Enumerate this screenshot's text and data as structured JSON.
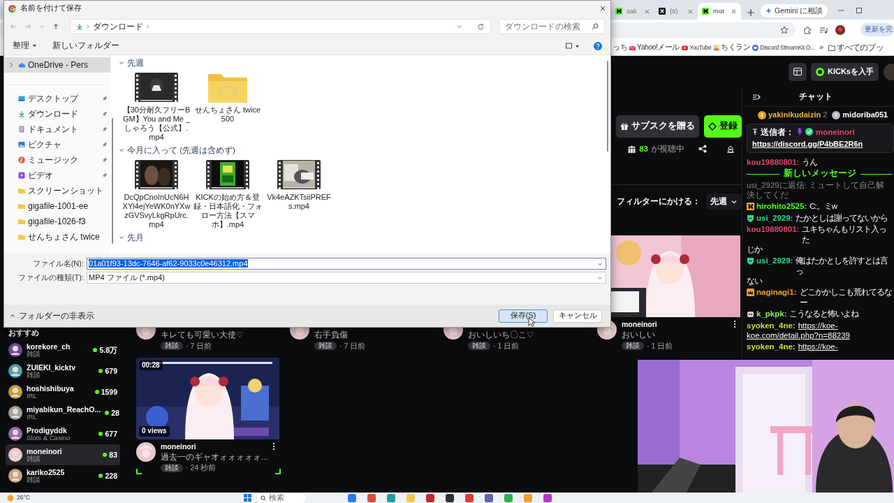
{
  "browser": {
    "tabs": [
      {
        "label": "sak",
        "selected": false
      },
      {
        "label": "(8)",
        "selected": false
      },
      {
        "label": "mor",
        "selected": true
      }
    ],
    "gemini": "Gemini に相談",
    "update": "更新を完",
    "bookmarks": [
      {
        "label": "っち"
      },
      {
        "label": "Yahoo!メール"
      },
      {
        "label": "YouTube"
      },
      {
        "label": "ちくラン"
      },
      {
        "label": "Discord StreamKit O..."
      }
    ],
    "more": "»",
    "all_bookmarks": "すべてのブッ"
  },
  "page": {
    "kicks": "KICKsを入手",
    "actions": [
      {
        "kind": "gift",
        "label": "サブスクを贈る"
      },
      {
        "kind": "follow",
        "label": "登録"
      }
    ],
    "viewers": {
      "count": "83",
      "label": "が視聴中"
    },
    "filter": {
      "label": "フィルターにかける：",
      "value": "先週"
    },
    "videos": [
      {
        "title": "キレても可愛い大使♡",
        "tag": "雑談",
        "time": "· 7 日前"
      },
      {
        "title": "右手負傷",
        "tag": "雑談",
        "time": "· 7 日前"
      },
      {
        "title": "おいしいち〇こ♡",
        "tag": "雑談",
        "time": "· 1 日前"
      },
      {
        "channel": "moneinori",
        "title": "おいしい",
        "tag": "雑談",
        "time": "· 1 日前"
      },
      {
        "channel": "moneinori",
        "title": "過去一のギャオォォォォォ...",
        "tag": "雑談",
        "time": "· 24 秒前",
        "duration": "00:28",
        "views": "0 views",
        "selected": true
      }
    ],
    "sidebar": {
      "title": "おすすめ",
      "channels": [
        {
          "name": "korekore_ch",
          "category": "雑談",
          "viewers": "5.8万",
          "selected": false
        },
        {
          "name": "ZUIEKI_kicktv",
          "category": "雑談",
          "viewers": "679",
          "selected": false
        },
        {
          "name": "hoshishibuya",
          "category": "IRL",
          "viewers": "1599",
          "selected": false
        },
        {
          "name": "miyabikun_ReachO...",
          "category": "IRL",
          "viewers": "28",
          "selected": false
        },
        {
          "name": "Prodigyddk",
          "category": "Slots & Casino",
          "viewers": "677",
          "selected": false
        },
        {
          "name": "moneinori",
          "category": "雑談",
          "viewers": "83",
          "selected": true
        },
        {
          "name": "kariko2525",
          "category": "雑談",
          "viewers": "228",
          "selected": false
        }
      ]
    },
    "chat": {
      "title": "チャット",
      "leaders": [
        {
          "rank": "1",
          "name": "yakinikudaizin",
          "count": "2",
          "color": "#e8a317"
        },
        {
          "rank": "2",
          "name": "midoriba051",
          "color": "#b8b8b8"
        }
      ],
      "pinned": {
        "label": "送信者：",
        "user": "moneinori",
        "link": "https://discord.gg/P4bBE2R6n"
      },
      "messages": [
        {
          "kind": "message",
          "user": "kou19880801:",
          "color": "#e0456a",
          "lines": [
            "うん"
          ]
        },
        {
          "kind": "divider",
          "text": "新しいメッセージ"
        },
        {
          "kind": "reply",
          "text": "usi_2929に返信: ミュートして自己解決してくだ"
        },
        {
          "kind": "message",
          "user": "hirohito2525:",
          "color": "#53fc18",
          "lines": [
            "C:。ミw"
          ]
        },
        {
          "kind": "message",
          "user": "usi_2929:",
          "color": "#2bd98a",
          "lines": [
            "たかとしは謝ってないから"
          ]
        },
        {
          "kind": "message",
          "user": "kou19880801:",
          "color": "#e0456a",
          "lines": [
            "ユキちゃんもリスト入った",
            "じか"
          ]
        },
        {
          "kind": "message",
          "user": "usi_2929:",
          "color": "#2bd98a",
          "lines": [
            "俺はたかとしを許すとは言っ",
            "ない"
          ]
        },
        {
          "kind": "message",
          "user": "naginagi1:",
          "color": "#f0a030",
          "lines": [
            "どこかかしこも荒れてるなー"
          ]
        },
        {
          "kind": "message",
          "user": "k_pkpk:",
          "color": "#8ef05a",
          "lines": [
            "こうなると怖いよね"
          ]
        },
        {
          "kind": "message",
          "user": "syoken_4ne:",
          "color": "#c4e23a",
          "link": true,
          "lines": [
            "https://koe-",
            "koe.com/detail.php?n=88239"
          ]
        },
        {
          "kind": "message",
          "user": "syoken_4ne:",
          "color": "#c4e23a",
          "link": true,
          "lines": [
            "https://koe-"
          ]
        }
      ]
    }
  },
  "dialog": {
    "title": "名前を付けて保存",
    "path": [
      {
        "kind": "separator",
        "text": "›"
      },
      {
        "kind": "folder",
        "text": "ダウンロード"
      },
      {
        "kind": "separator",
        "text": "›"
      }
    ],
    "search_placeholder": "ダウンロードの検索",
    "commands": [
      {
        "label": "整理",
        "dropdown": true
      },
      {
        "label": "新しいフォルダー",
        "dropdown": false
      }
    ],
    "nav": [
      {
        "label": "OneDrive - Pers",
        "selected": true,
        "expandable": true,
        "pinned": false
      },
      {
        "label": "デスクトップ",
        "selected": false,
        "expandable": false,
        "pinned": true
      },
      {
        "label": "ダウンロード",
        "selected": false,
        "expandable": false,
        "pinned": true
      },
      {
        "label": "ドキュメント",
        "selected": false,
        "expandable": false,
        "pinned": true
      },
      {
        "label": "ピクチャ",
        "selected": false,
        "expandable": false,
        "pinned": true
      },
      {
        "label": "ミュージック",
        "selected": false,
        "expandable": false,
        "pinned": true
      },
      {
        "label": "ビデオ",
        "selected": false,
        "expandable": false,
        "pinned": true
      },
      {
        "label": "スクリーンショット",
        "selected": false,
        "expandable": false,
        "pinned": false
      },
      {
        "label": "gigafile-1001-ee",
        "selected": false,
        "expandable": false,
        "pinned": false
      },
      {
        "label": "gigafile-1026-f3",
        "selected": false,
        "expandable": false,
        "pinned": false
      },
      {
        "label": "せんちょさん twice",
        "selected": false,
        "expandable": false,
        "pinned": false
      }
    ],
    "groups": [
      {
        "label": "先週",
        "expanded": true,
        "items": [
          {
            "kind": "video",
            "name": "【30分耐久フリーBGM】You and Me _しゃろう【公式】.mp4"
          },
          {
            "kind": "folder",
            "name": "せんちょさん twice500"
          }
        ]
      },
      {
        "label": "今月に入って (先週は含めず)",
        "expanded": true,
        "items": [
          {
            "kind": "video",
            "name": "DcQpCnoInUcN6HXYl4ejYeWK0nYXwzGVSvyLkgRpUrc.mp4"
          },
          {
            "kind": "video",
            "name": "KICKの始め方＆登録・日本語化・フォロー方法【スマホ】.mp4"
          },
          {
            "kind": "video",
            "name": "Vk4eAZKTsiiPREFs.mp4"
          }
        ]
      },
      {
        "label": "先月",
        "expanded": true
      }
    ],
    "filename": {
      "label": "ファイル名(N):",
      "value": "01a01f93-13dc-7646-af62-9033c0e46312.mp4",
      "selected": true
    },
    "filetype": {
      "label": "ファイルの種類(T):",
      "value": "MP4 ファイル (*.mp4)"
    },
    "hide_folders": "フォルダーの非表示",
    "buttons": [
      {
        "label": "保存(S)",
        "default": true
      },
      {
        "label": "キャンセル",
        "default": false
      }
    ]
  },
  "taskbar": {
    "weather": "26°C",
    "search_placeholder": "検索"
  }
}
